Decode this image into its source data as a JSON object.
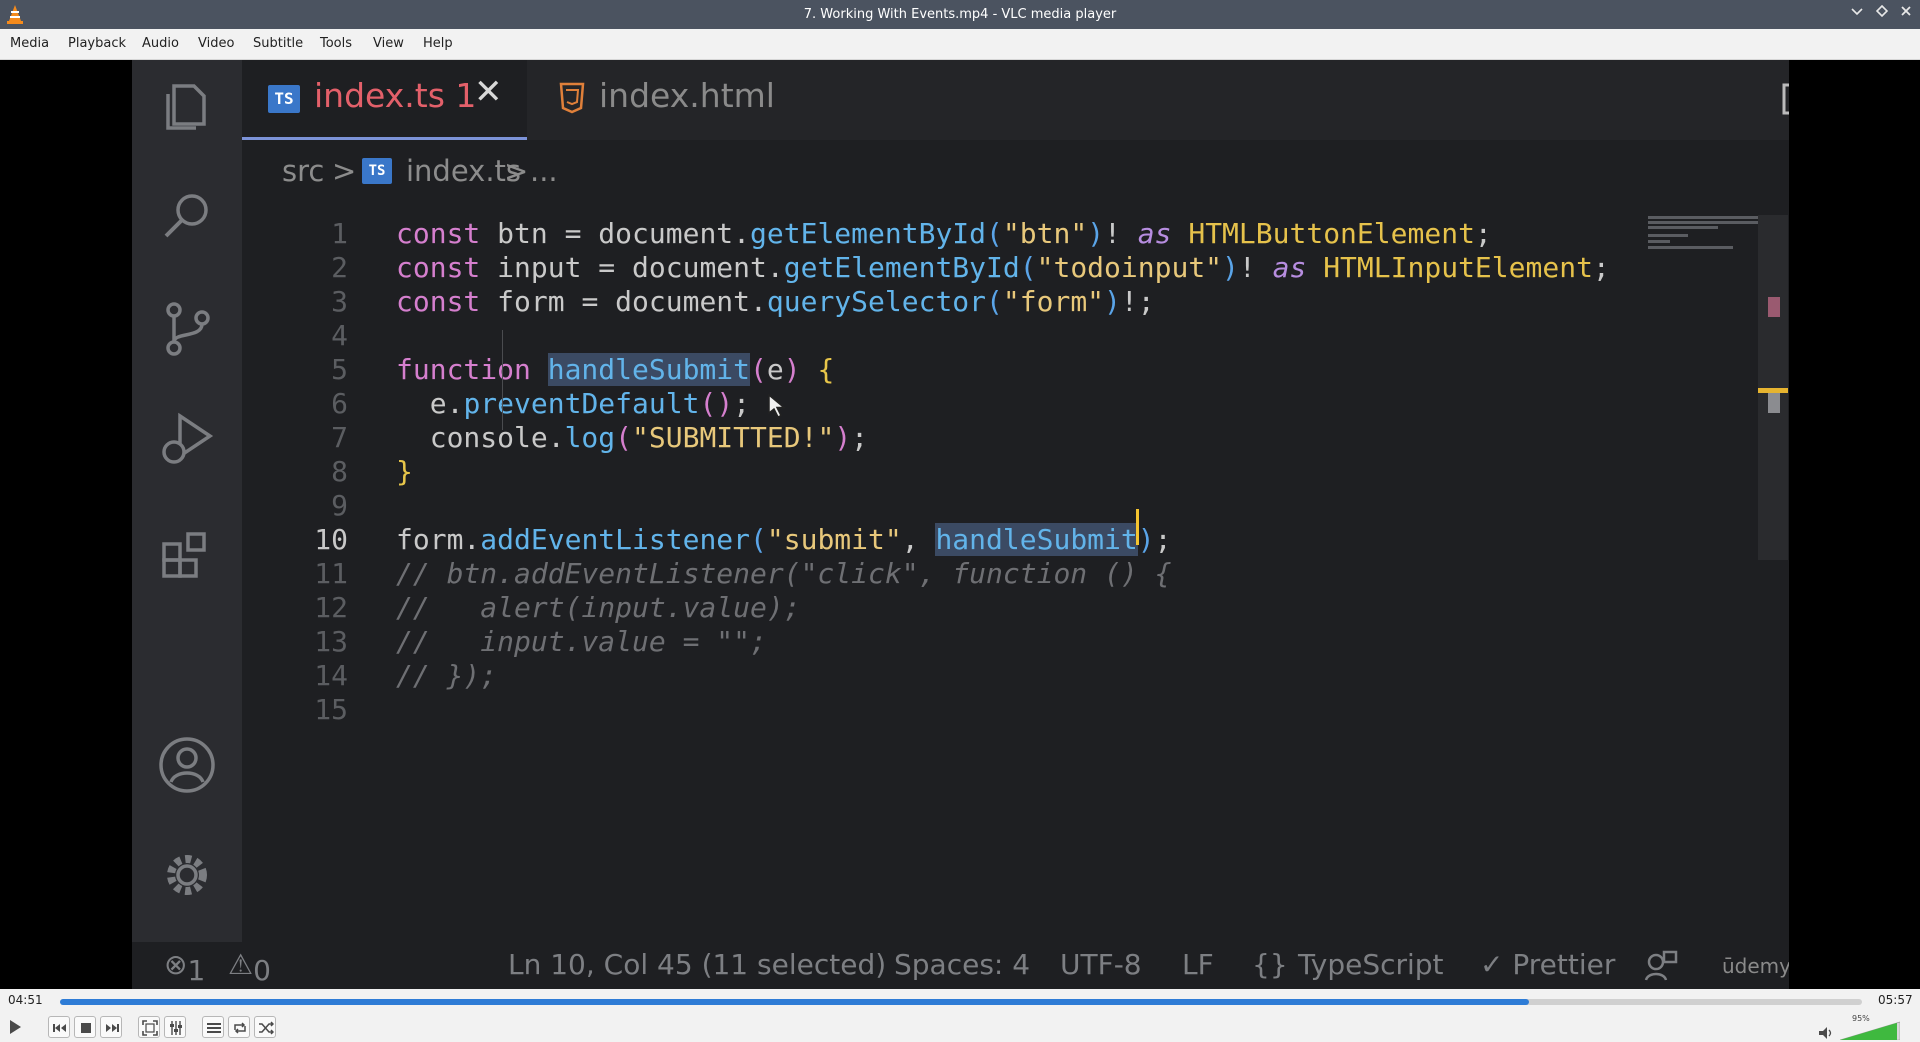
{
  "window": {
    "title": "7. Working With Events.mp4 - VLC media player",
    "buttons": [
      "minimize",
      "maximize",
      "close"
    ]
  },
  "menu": [
    "Media",
    "Playback",
    "Audio",
    "Video",
    "Subtitle",
    "Tools",
    "View",
    "Help"
  ],
  "video": {
    "tabs": [
      {
        "logo": "TS",
        "label": "index.ts",
        "badge": "1",
        "active": true
      },
      {
        "label": "index.html",
        "active": false
      }
    ],
    "breadcrumb": {
      "folder": "src",
      "sep": ">",
      "logo": "TS",
      "file": "index.ts",
      "tail": "..."
    },
    "line_numbers": [
      "1",
      "2",
      "3",
      "4",
      "5",
      "6",
      "7",
      "8",
      "9",
      "10",
      "11",
      "12",
      "13",
      "14",
      "15"
    ],
    "code_lines": [
      "const btn = document.getElementById(\"btn\")! as HTMLButtonElement;",
      "const input = document.getElementById(\"todoinput\")! as HTMLInputElement;",
      "const form = document.querySelector(\"form\")!;",
      "",
      "function handleSubmit(e) {",
      "  e.preventDefault();",
      "  console.log(\"SUBMITTED!\");",
      "}",
      "",
      "form.addEventListener(\"submit\", handleSubmit);",
      "// btn.addEventListener(\"click\", function () {",
      "//   alert(input.value);",
      "//   input.value = \"\";",
      "// });",
      ""
    ],
    "status": {
      "errors": "1",
      "warnings": "0",
      "position": "Ln 10, Col 45 (11 selected)",
      "spaces": "Spaces: 4",
      "encoding": "UTF-8",
      "eol": "LF",
      "language_braces": "{}",
      "language": "TypeScript",
      "prettier": "✓ Prettier",
      "watermark": "ūdemy"
    }
  },
  "player": {
    "elapsed": "04:51",
    "total": "05:57",
    "progress": 0.815,
    "volume_label": "95%",
    "volume": 0.95
  },
  "colors": {
    "titlebar": "#4b5360",
    "progress": "#2e7cd6",
    "volume": "#3fb93f"
  }
}
